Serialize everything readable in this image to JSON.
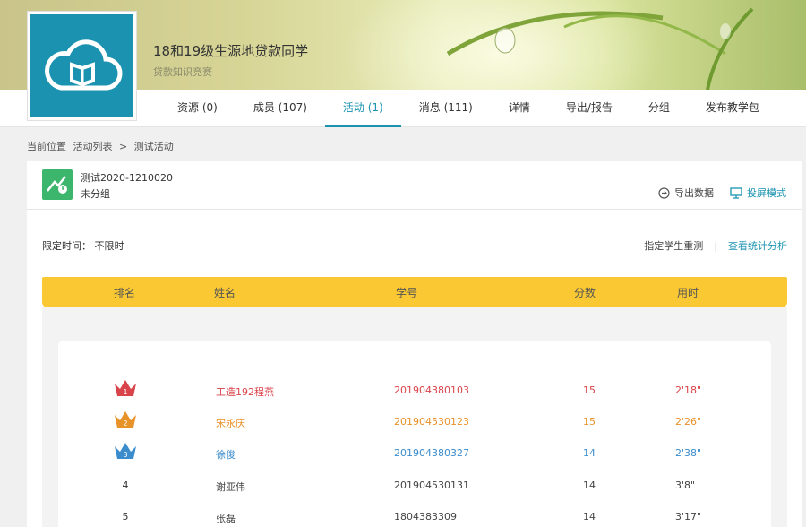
{
  "group": {
    "title": "18和19级生源地贷款同学",
    "subtitle": "贷款知识竞赛"
  },
  "tabs": [
    {
      "label": "资源 (0)",
      "active": false
    },
    {
      "label": "成员 (107)",
      "active": false
    },
    {
      "label": "活动 (1)",
      "active": true
    },
    {
      "label": "消息 (111)",
      "active": false
    },
    {
      "label": "详情",
      "active": false
    },
    {
      "label": "导出/报告",
      "active": false
    },
    {
      "label": "分组",
      "active": false
    },
    {
      "label": "发布教学包",
      "active": false
    }
  ],
  "breadcrumb": {
    "prefix": "当前位置",
    "parent": "活动列表",
    "sep": ">",
    "current": "测试活动"
  },
  "activity": {
    "name": "测试2020-1210020",
    "group": "未分组",
    "export_label": "导出数据",
    "projection_label": "投屏模式",
    "limit_label": "限定时间： 不限时",
    "retest_label": "指定学生重测",
    "stats_label": "查看统计分析"
  },
  "table": {
    "headers": {
      "rank": "排名",
      "name": "姓名",
      "id": "学号",
      "score": "分数",
      "time": "用时"
    },
    "rows": [
      {
        "rank": "1",
        "name": "工造192程燕",
        "id": "201904380103",
        "score": "15",
        "time": "2'18\"",
        "color": "#d9434a"
      },
      {
        "rank": "2",
        "name": "宋永庆",
        "id": "201904530123",
        "score": "15",
        "time": "2'26\"",
        "color": "#e8922a"
      },
      {
        "rank": "3",
        "name": "徐俊",
        "id": "201904380327",
        "score": "14",
        "time": "2'38\"",
        "color": "#3a8ccc"
      },
      {
        "rank": "4",
        "name": "谢亚伟",
        "id": "201904530131",
        "score": "14",
        "time": "3'8\"",
        "color": "#444444"
      },
      {
        "rank": "5",
        "name": "张磊",
        "id": "1804383309",
        "score": "14",
        "time": "3'17\"",
        "color": "#444444"
      }
    ]
  },
  "colors": {
    "accent": "#1b93b0",
    "header_bg": "#f9c832",
    "activity_icon": "#3db66d"
  }
}
